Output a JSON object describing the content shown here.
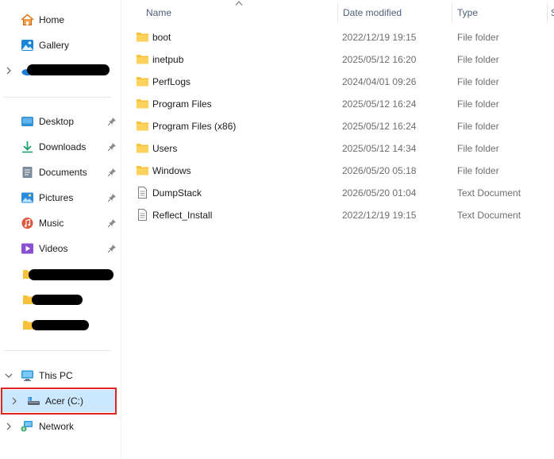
{
  "nav": {
    "home": "Home",
    "gallery": "Gallery",
    "desktop": "Desktop",
    "downloads": "Downloads",
    "documents": "Documents",
    "pictures": "Pictures",
    "music": "Music",
    "videos": "Videos",
    "this_pc": "This PC",
    "acer": "Acer (C:)",
    "network": "Network"
  },
  "columns": {
    "name": "Name",
    "date_modified": "Date modified",
    "type": "Type",
    "size": "S"
  },
  "files": [
    {
      "name": "boot",
      "date": "2022/12/19 19:15",
      "type": "File folder",
      "icon": "folder-icon"
    },
    {
      "name": "inetpub",
      "date": "2025/05/12 16:20",
      "type": "File folder",
      "icon": "folder-icon"
    },
    {
      "name": "PerfLogs",
      "date": "2024/04/01 09:26",
      "type": "File folder",
      "icon": "folder-icon"
    },
    {
      "name": "Program Files",
      "date": "2025/05/12 16:24",
      "type": "File folder",
      "icon": "folder-icon"
    },
    {
      "name": "Program Files (x86)",
      "date": "2025/05/12 16:24",
      "type": "File folder",
      "icon": "folder-icon"
    },
    {
      "name": "Users",
      "date": "2025/05/12 14:34",
      "type": "File folder",
      "icon": "folder-icon"
    },
    {
      "name": "Windows",
      "date": "2026/05/20 05:18",
      "type": "File folder",
      "icon": "folder-icon"
    },
    {
      "name": "DumpStack",
      "date": "2026/05/20 01:04",
      "type": "Text Document",
      "icon": "text-document-icon"
    },
    {
      "name": "Reflect_Install",
      "date": "2022/12/19 19:15",
      "type": "Text Document",
      "icon": "text-document-icon"
    }
  ],
  "colors": {
    "selected_background": "#cce8ff",
    "highlight_border": "#e32222",
    "folder": "#f8c13a",
    "header_text": "#4c607a"
  }
}
